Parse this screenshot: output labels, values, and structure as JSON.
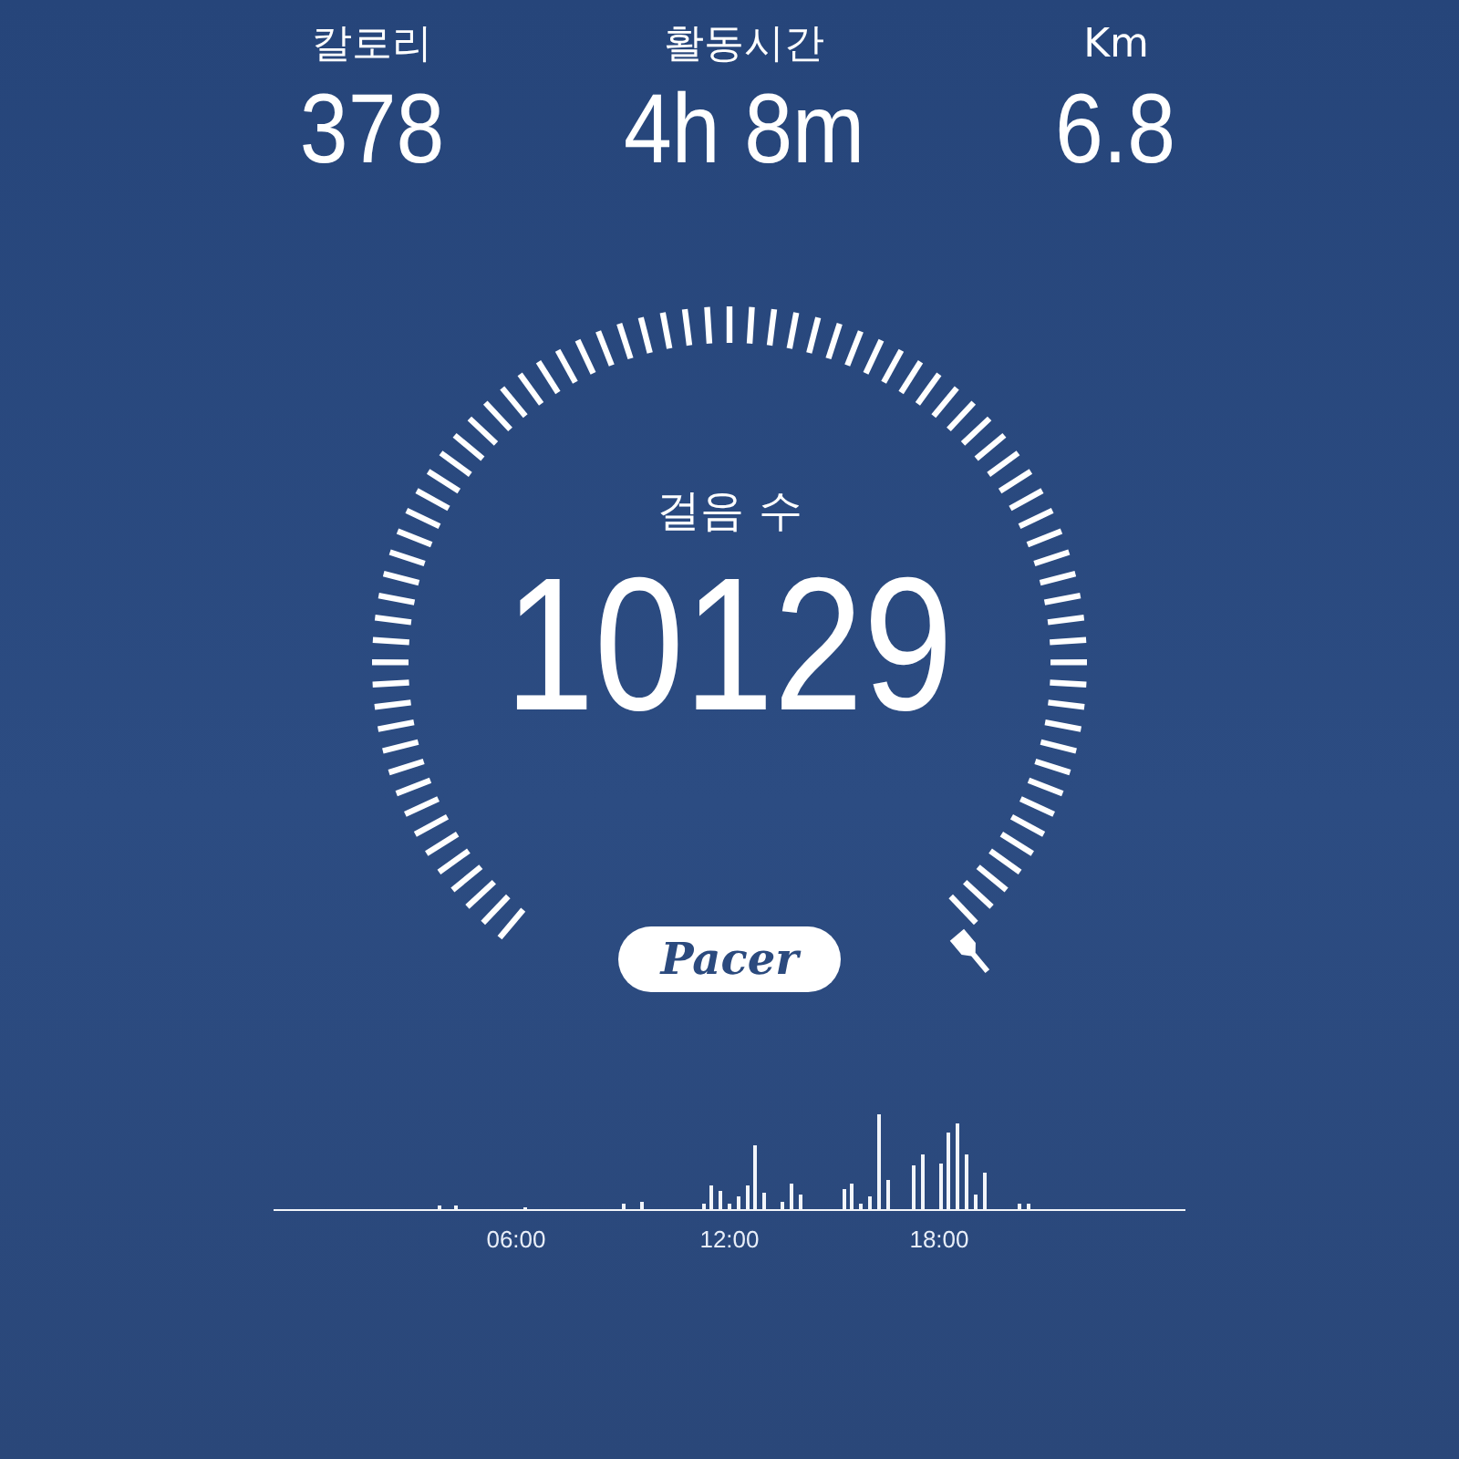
{
  "stats": [
    {
      "label": "칼로리",
      "value": "378"
    },
    {
      "label": "활동시간",
      "value": "4h 8m"
    },
    {
      "label": "Km",
      "value": "6.8"
    }
  ],
  "gauge": {
    "label": "걸음 수",
    "value": "10129"
  },
  "logo": "Pacer",
  "activity_chart": {
    "x_labels": [
      "06:00",
      "12:00",
      "18:00"
    ]
  }
}
